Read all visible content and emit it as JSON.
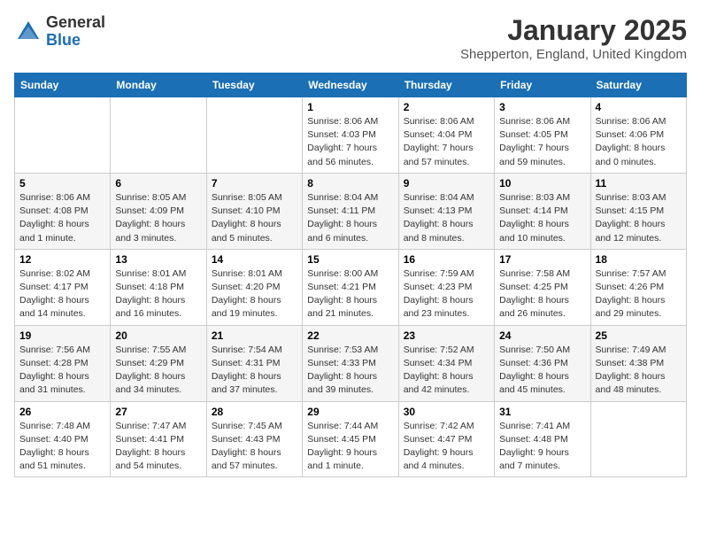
{
  "logo": {
    "general": "General",
    "blue": "Blue"
  },
  "title": "January 2025",
  "location": "Shepperton, England, United Kingdom",
  "days_of_week": [
    "Sunday",
    "Monday",
    "Tuesday",
    "Wednesday",
    "Thursday",
    "Friday",
    "Saturday"
  ],
  "weeks": [
    [
      {
        "day": "",
        "info": ""
      },
      {
        "day": "",
        "info": ""
      },
      {
        "day": "",
        "info": ""
      },
      {
        "day": "1",
        "info": "Sunrise: 8:06 AM\nSunset: 4:03 PM\nDaylight: 7 hours\nand 56 minutes."
      },
      {
        "day": "2",
        "info": "Sunrise: 8:06 AM\nSunset: 4:04 PM\nDaylight: 7 hours\nand 57 minutes."
      },
      {
        "day": "3",
        "info": "Sunrise: 8:06 AM\nSunset: 4:05 PM\nDaylight: 7 hours\nand 59 minutes."
      },
      {
        "day": "4",
        "info": "Sunrise: 8:06 AM\nSunset: 4:06 PM\nDaylight: 8 hours\nand 0 minutes."
      }
    ],
    [
      {
        "day": "5",
        "info": "Sunrise: 8:06 AM\nSunset: 4:08 PM\nDaylight: 8 hours\nand 1 minute."
      },
      {
        "day": "6",
        "info": "Sunrise: 8:05 AM\nSunset: 4:09 PM\nDaylight: 8 hours\nand 3 minutes."
      },
      {
        "day": "7",
        "info": "Sunrise: 8:05 AM\nSunset: 4:10 PM\nDaylight: 8 hours\nand 5 minutes."
      },
      {
        "day": "8",
        "info": "Sunrise: 8:04 AM\nSunset: 4:11 PM\nDaylight: 8 hours\nand 6 minutes."
      },
      {
        "day": "9",
        "info": "Sunrise: 8:04 AM\nSunset: 4:13 PM\nDaylight: 8 hours\nand 8 minutes."
      },
      {
        "day": "10",
        "info": "Sunrise: 8:03 AM\nSunset: 4:14 PM\nDaylight: 8 hours\nand 10 minutes."
      },
      {
        "day": "11",
        "info": "Sunrise: 8:03 AM\nSunset: 4:15 PM\nDaylight: 8 hours\nand 12 minutes."
      }
    ],
    [
      {
        "day": "12",
        "info": "Sunrise: 8:02 AM\nSunset: 4:17 PM\nDaylight: 8 hours\nand 14 minutes."
      },
      {
        "day": "13",
        "info": "Sunrise: 8:01 AM\nSunset: 4:18 PM\nDaylight: 8 hours\nand 16 minutes."
      },
      {
        "day": "14",
        "info": "Sunrise: 8:01 AM\nSunset: 4:20 PM\nDaylight: 8 hours\nand 19 minutes."
      },
      {
        "day": "15",
        "info": "Sunrise: 8:00 AM\nSunset: 4:21 PM\nDaylight: 8 hours\nand 21 minutes."
      },
      {
        "day": "16",
        "info": "Sunrise: 7:59 AM\nSunset: 4:23 PM\nDaylight: 8 hours\nand 23 minutes."
      },
      {
        "day": "17",
        "info": "Sunrise: 7:58 AM\nSunset: 4:25 PM\nDaylight: 8 hours\nand 26 minutes."
      },
      {
        "day": "18",
        "info": "Sunrise: 7:57 AM\nSunset: 4:26 PM\nDaylight: 8 hours\nand 29 minutes."
      }
    ],
    [
      {
        "day": "19",
        "info": "Sunrise: 7:56 AM\nSunset: 4:28 PM\nDaylight: 8 hours\nand 31 minutes."
      },
      {
        "day": "20",
        "info": "Sunrise: 7:55 AM\nSunset: 4:29 PM\nDaylight: 8 hours\nand 34 minutes."
      },
      {
        "day": "21",
        "info": "Sunrise: 7:54 AM\nSunset: 4:31 PM\nDaylight: 8 hours\nand 37 minutes."
      },
      {
        "day": "22",
        "info": "Sunrise: 7:53 AM\nSunset: 4:33 PM\nDaylight: 8 hours\nand 39 minutes."
      },
      {
        "day": "23",
        "info": "Sunrise: 7:52 AM\nSunset: 4:34 PM\nDaylight: 8 hours\nand 42 minutes."
      },
      {
        "day": "24",
        "info": "Sunrise: 7:50 AM\nSunset: 4:36 PM\nDaylight: 8 hours\nand 45 minutes."
      },
      {
        "day": "25",
        "info": "Sunrise: 7:49 AM\nSunset: 4:38 PM\nDaylight: 8 hours\nand 48 minutes."
      }
    ],
    [
      {
        "day": "26",
        "info": "Sunrise: 7:48 AM\nSunset: 4:40 PM\nDaylight: 8 hours\nand 51 minutes."
      },
      {
        "day": "27",
        "info": "Sunrise: 7:47 AM\nSunset: 4:41 PM\nDaylight: 8 hours\nand 54 minutes."
      },
      {
        "day": "28",
        "info": "Sunrise: 7:45 AM\nSunset: 4:43 PM\nDaylight: 8 hours\nand 57 minutes."
      },
      {
        "day": "29",
        "info": "Sunrise: 7:44 AM\nSunset: 4:45 PM\nDaylight: 9 hours\nand 1 minute."
      },
      {
        "day": "30",
        "info": "Sunrise: 7:42 AM\nSunset: 4:47 PM\nDaylight: 9 hours\nand 4 minutes."
      },
      {
        "day": "31",
        "info": "Sunrise: 7:41 AM\nSunset: 4:48 PM\nDaylight: 9 hours\nand 7 minutes."
      },
      {
        "day": "",
        "info": ""
      }
    ]
  ]
}
